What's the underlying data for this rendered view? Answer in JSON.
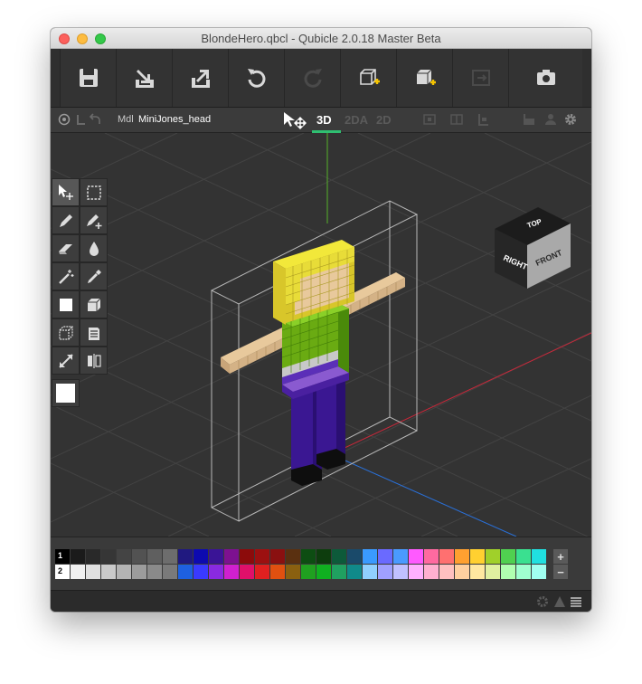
{
  "window": {
    "title": "BlondeHero.qbcl - Qubicle 2.0.18 Master Beta"
  },
  "toolbar": {
    "buttons": [
      "save-icon",
      "import-icon",
      "export-icon",
      "undo-icon",
      "redo-icon",
      "new-matrix-icon",
      "new-cube-icon",
      "transform-icon",
      "screenshot-icon"
    ]
  },
  "subbar": {
    "mode_prefix": "Mdl",
    "model_name": "MiniJones_head",
    "modes": [
      "3D",
      "2DA",
      "2D"
    ],
    "active_mode": "3D"
  },
  "navcube": {
    "top": "TOP",
    "right": "RIGHT",
    "front": "FRONT"
  },
  "tools": [
    "select-move",
    "marquee-select",
    "pencil",
    "pencil-add",
    "eraser",
    "fill-drop",
    "magic-wand",
    "eyedropper",
    "add-cube",
    "extrude-cube",
    "wire-cube",
    "slice",
    "resize",
    "mirror"
  ],
  "current_color": "#ffffff",
  "palette": {
    "row1_label": "1",
    "row2_label": "2",
    "row1": [
      "#000000",
      "#1b1b1b",
      "#292929",
      "#363636",
      "#444444",
      "#525252",
      "#5f5f5f",
      "#6d6d6d",
      "#201980",
      "#0d0ab0",
      "#3a1496",
      "#7d1190",
      "#8c0b0b",
      "#9c1010",
      "#8a1010",
      "#5a3010",
      "#0d4d12",
      "#0d3d0d",
      "#0d5a3a",
      "#1a4a6a",
      "#3a9aff",
      "#6a6aff",
      "#4a9aff",
      "#ff5aff",
      "#ff6aa0",
      "#ff7070",
      "#ffa030",
      "#ffd030",
      "#a0d02a",
      "#50d050",
      "#3ae090",
      "#20e0e0"
    ],
    "row2": [
      "#ffffff",
      "#f0f0f0",
      "#e0e0e0",
      "#cacaca",
      "#b4b4b4",
      "#9c9c9c",
      "#8a8a8a",
      "#7a7a7a",
      "#1e60e0",
      "#3a3aff",
      "#8a2ae0",
      "#d020d0",
      "#e0106a",
      "#e02020",
      "#e05010",
      "#8a6010",
      "#20a020",
      "#10b020",
      "#20a060",
      "#108a8a",
      "#90d0ff",
      "#a0a0ff",
      "#c0c0ff",
      "#ffb0ff",
      "#ffb0d0",
      "#ffc0c0",
      "#ffd0a0",
      "#ffe8a0",
      "#e0f0a0",
      "#b0ffb0",
      "#a0ffd0",
      "#a0fff0"
    ],
    "add_label": "+",
    "remove_label": "−"
  }
}
